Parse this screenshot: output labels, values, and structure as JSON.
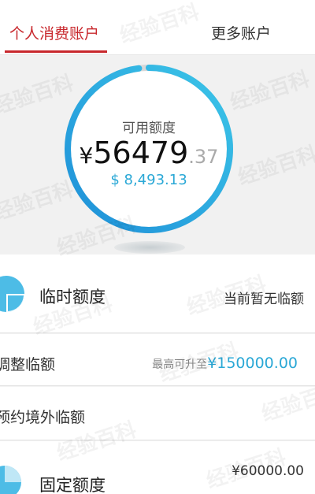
{
  "tabs": {
    "personal": "个人消费账户",
    "more": "更多账户"
  },
  "hero": {
    "label": "可用额度",
    "currency": "¥",
    "amount_int": "56479",
    "amount_dec": ".37",
    "usd": "$ 8,493.13",
    "ring_color": "#29a3db",
    "ring_progress": 0.98
  },
  "temp_limit": {
    "title": "临时额度",
    "status": "当前暂无临额",
    "adjust": {
      "label": "调整临额",
      "prefix": "最高可升至",
      "value": "¥150000.00"
    },
    "abroad": {
      "label": "预约境外临额"
    }
  },
  "fixed_limit": {
    "title": "固定额度",
    "amount": "¥60000.00"
  },
  "watermark": "经验百科",
  "colors": {
    "accent": "#c8282d",
    "blue": "#2aa8d6"
  }
}
